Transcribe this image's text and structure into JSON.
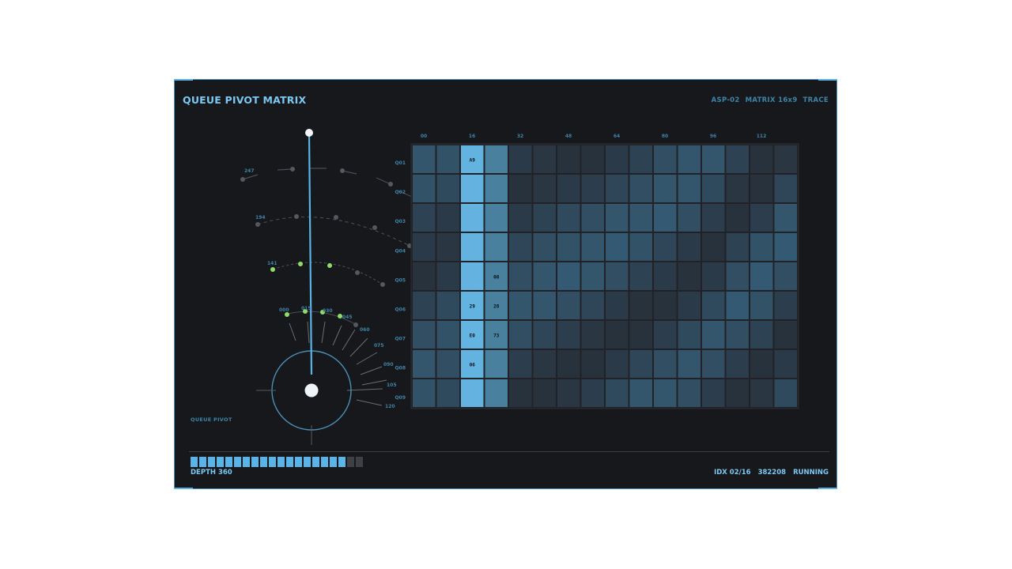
{
  "header": {
    "title": "QUEUE PIVOT MATRIX",
    "meta": [
      "ASP-02",
      "MATRIX 16x9",
      "TRACE"
    ]
  },
  "side_label": "QUEUE PIVOT",
  "footer": {
    "depth": "DEPTH 360",
    "index": "IDX 02/16",
    "counter": "382208",
    "status": "RUNNING"
  },
  "progress": {
    "total": 20,
    "filled": 18
  },
  "colors": {
    "accent": "#5ab4e8",
    "node_active": "#8fdc6a",
    "node_idle": "#55585e"
  },
  "dial": {
    "arc_labels": [
      "247",
      "194",
      "141"
    ],
    "inner_labels": [
      "000",
      "015",
      "030",
      "045"
    ],
    "tick_labels": [
      "060",
      "075",
      "090",
      "105",
      "120"
    ]
  },
  "matrix": {
    "column_labels": [
      "00",
      "16",
      "32",
      "48",
      "64",
      "80",
      "96",
      "112"
    ],
    "row_labels": [
      "Q01",
      "Q02",
      "Q03",
      "Q04",
      "Q05",
      "Q06",
      "Q07",
      "Q08",
      "Q09"
    ],
    "cell_labels": [
      {
        "r": 0,
        "c": 2,
        "text": "A9"
      },
      {
        "r": 4,
        "c": 3,
        "text": "00"
      },
      {
        "r": 5,
        "c": 2,
        "text": "29"
      },
      {
        "r": 5,
        "c": 3,
        "text": "28"
      },
      {
        "r": 6,
        "c": 2,
        "text": "E0"
      },
      {
        "r": 6,
        "c": 3,
        "text": "73"
      },
      {
        "r": 7,
        "c": 2,
        "text": "06"
      }
    ],
    "values": [
      [
        0.55,
        0.5,
        0.95,
        0.7,
        0.2,
        0.15,
        0.1,
        0.1,
        0.2,
        0.3,
        0.45,
        0.55,
        0.55,
        0.3,
        0.1,
        0.15
      ],
      [
        0.5,
        0.4,
        0.9,
        0.65,
        0.1,
        0.15,
        0.2,
        0.25,
        0.35,
        0.45,
        0.55,
        0.55,
        0.4,
        0.15,
        0.1,
        0.35
      ],
      [
        0.3,
        0.2,
        0.88,
        0.6,
        0.2,
        0.3,
        0.4,
        0.45,
        0.55,
        0.55,
        0.6,
        0.45,
        0.25,
        0.1,
        0.25,
        0.55
      ],
      [
        0.2,
        0.15,
        0.88,
        0.6,
        0.35,
        0.45,
        0.5,
        0.55,
        0.6,
        0.5,
        0.35,
        0.2,
        0.1,
        0.3,
        0.5,
        0.6
      ],
      [
        0.1,
        0.2,
        0.92,
        0.65,
        0.45,
        0.55,
        0.6,
        0.55,
        0.45,
        0.3,
        0.2,
        0.1,
        0.2,
        0.45,
        0.6,
        0.45
      ],
      [
        0.3,
        0.4,
        0.95,
        0.7,
        0.55,
        0.55,
        0.45,
        0.35,
        0.2,
        0.1,
        0.1,
        0.2,
        0.4,
        0.6,
        0.5,
        0.25
      ],
      [
        0.45,
        0.5,
        1.0,
        0.72,
        0.45,
        0.35,
        0.25,
        0.15,
        0.1,
        0.1,
        0.25,
        0.4,
        0.55,
        0.45,
        0.3,
        0.1
      ],
      [
        0.55,
        0.45,
        0.95,
        0.68,
        0.25,
        0.15,
        0.1,
        0.1,
        0.2,
        0.35,
        0.45,
        0.55,
        0.45,
        0.25,
        0.1,
        0.2
      ],
      [
        0.5,
        0.4,
        0.92,
        0.62,
        0.1,
        0.1,
        0.15,
        0.25,
        0.4,
        0.55,
        0.55,
        0.45,
        0.25,
        0.1,
        0.15,
        0.4
      ]
    ]
  }
}
